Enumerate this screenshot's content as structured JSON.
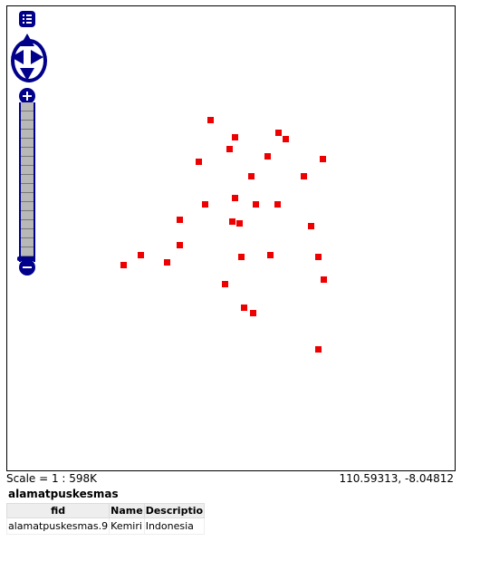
{
  "map": {
    "points": [
      {
        "x": 110.42,
        "y": -7.805
      },
      {
        "x": 110.437,
        "y": -7.817
      },
      {
        "x": 110.467,
        "y": -7.814
      },
      {
        "x": 110.472,
        "y": -7.818
      },
      {
        "x": 110.433,
        "y": -7.825
      },
      {
        "x": 110.412,
        "y": -7.834
      },
      {
        "x": 110.459,
        "y": -7.83
      },
      {
        "x": 110.497,
        "y": -7.832
      },
      {
        "x": 110.448,
        "y": -7.844
      },
      {
        "x": 110.484,
        "y": -7.844
      },
      {
        "x": 110.437,
        "y": -7.859
      },
      {
        "x": 110.416,
        "y": -7.863
      },
      {
        "x": 110.451,
        "y": -7.863
      },
      {
        "x": 110.466,
        "y": -7.863
      },
      {
        "x": 110.399,
        "y": -7.874
      },
      {
        "x": 110.435,
        "y": -7.875
      },
      {
        "x": 110.44,
        "y": -7.876
      },
      {
        "x": 110.489,
        "y": -7.878
      },
      {
        "x": 110.399,
        "y": -7.891
      },
      {
        "x": 110.372,
        "y": -7.898
      },
      {
        "x": 110.441,
        "y": -7.899
      },
      {
        "x": 110.461,
        "y": -7.898
      },
      {
        "x": 110.494,
        "y": -7.899
      },
      {
        "x": 110.36,
        "y": -7.905
      },
      {
        "x": 110.39,
        "y": -7.903
      },
      {
        "x": 110.498,
        "y": -7.915
      },
      {
        "x": 110.43,
        "y": -7.918
      },
      {
        "x": 110.443,
        "y": -7.934
      },
      {
        "x": 110.449,
        "y": -7.938
      },
      {
        "x": 110.494,
        "y": -7.963
      }
    ],
    "bounds": {
      "xmin": 110.28,
      "xmax": 110.588,
      "ymin": -8.046,
      "ymax": -7.727
    }
  },
  "status": {
    "scale": "Scale = 1 : 598K",
    "coords": "110.59313, -8.04812"
  },
  "feature_info": {
    "layer": "alamatpuskesmas",
    "headers": [
      "fid",
      "Name",
      "Descriptio"
    ],
    "rows": [
      [
        "alamatpuskesmas.9",
        "Kemiri",
        "Indonesia"
      ]
    ]
  },
  "colors": {
    "point": "#ee0000",
    "controls": "#00008b"
  },
  "icons": [
    "layer-switcher-icon",
    "pan-up-icon",
    "pan-down-icon",
    "pan-left-icon",
    "pan-right-icon",
    "zoom-in-icon",
    "zoom-out-icon"
  ]
}
